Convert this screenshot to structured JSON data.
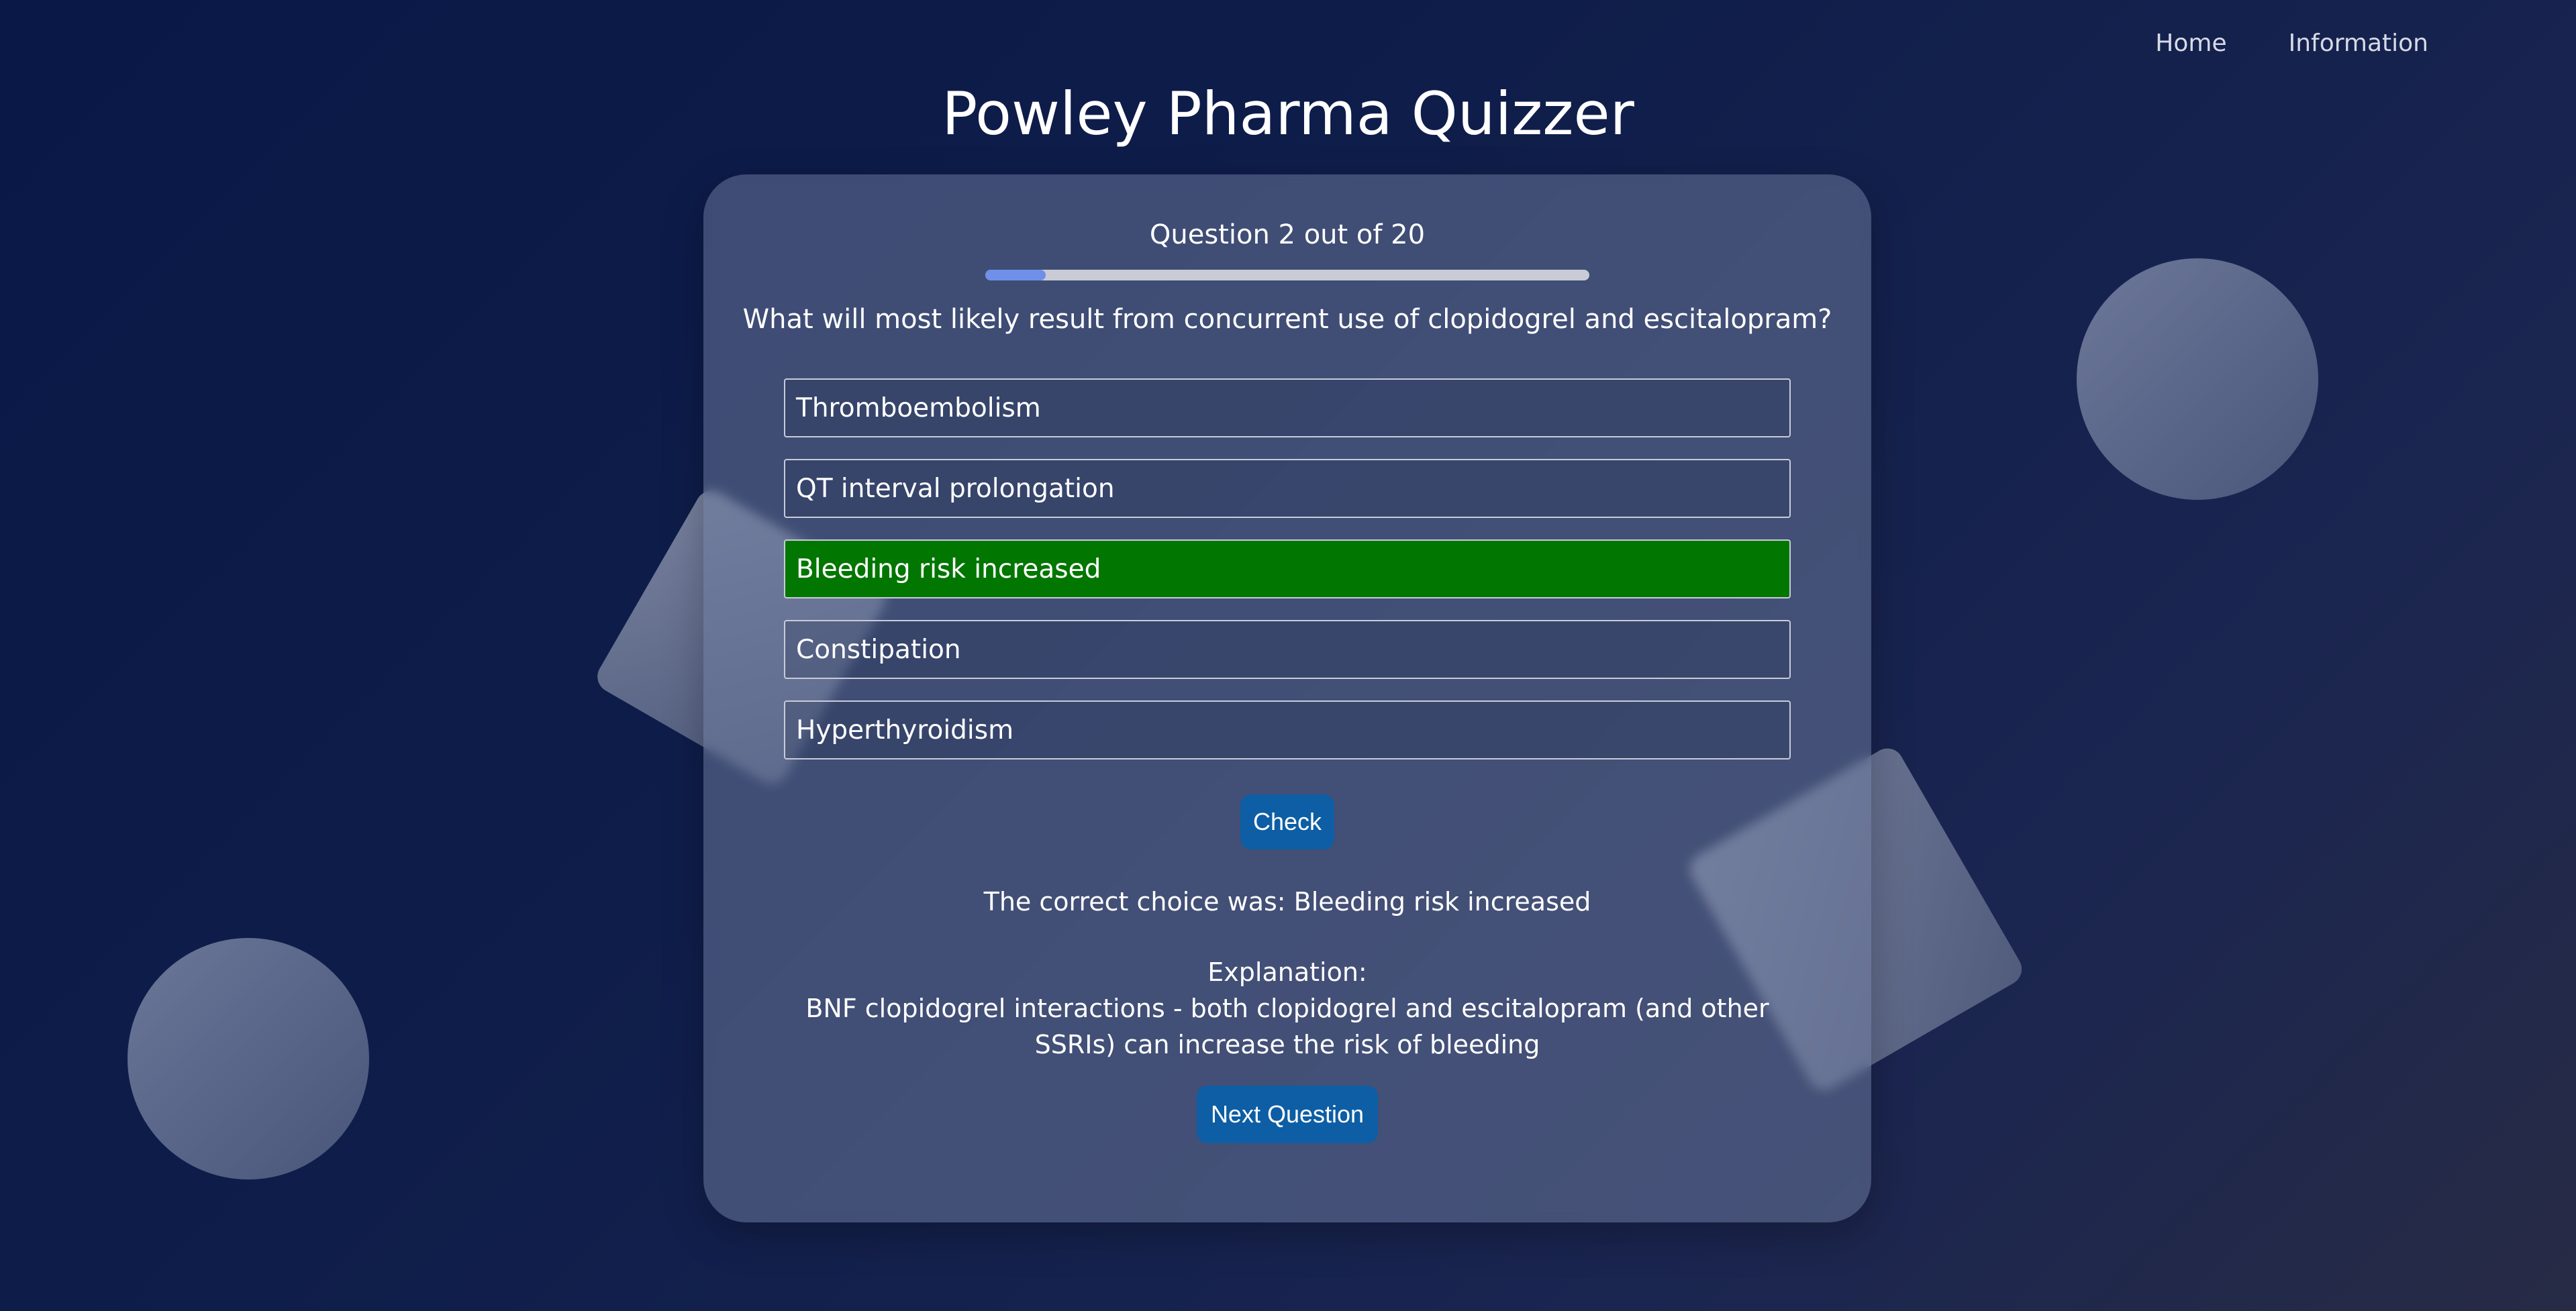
{
  "nav": {
    "home": "Home",
    "information": "Information"
  },
  "app": {
    "title": "Powley Pharma Quizzer"
  },
  "quiz": {
    "counter": "Question 2 out of 20",
    "progress_fraction": 0.1,
    "question": "What will most likely result from concurrent use of clopidogrel and escitalopram?",
    "options": [
      "Thromboembolism",
      "QT interval prolongation",
      "Bleeding risk increased",
      "Constipation",
      "Hyperthyroidism"
    ],
    "selected_correct_index": 2,
    "check_label": "Check",
    "result_text": "The correct choice was: Bleeding risk increased",
    "explanation_heading": "Explanation:",
    "explanation_text": "BNF clopidogrel interactions - both clopidogrel and escitalopram (and other SSRIs) can increase the risk of bleeding",
    "next_label": "Next Question"
  },
  "colors": {
    "correct_option": "#017601",
    "button": "#0d5ea4",
    "progress_fill": "#6f8fe8"
  }
}
